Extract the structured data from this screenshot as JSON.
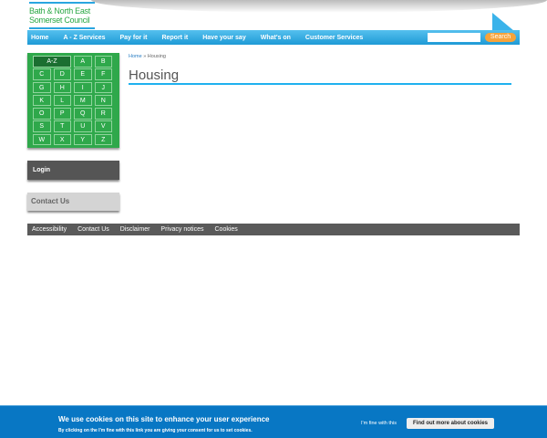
{
  "logo": {
    "line1": "Bath & North East",
    "line2": "Somerset Council"
  },
  "nav": [
    "Home",
    "A - Z Services",
    "Pay for it",
    "Report it",
    "Have your say",
    "What's on",
    "Customer Services"
  ],
  "search": {
    "placeholder": "",
    "button": "Search"
  },
  "az": {
    "all": "A-Z",
    "letters": [
      "A",
      "B",
      "C",
      "D",
      "E",
      "F",
      "G",
      "H",
      "I",
      "J",
      "K",
      "L",
      "M",
      "N",
      "O",
      "P",
      "Q",
      "R",
      "S",
      "T",
      "U",
      "V",
      "W",
      "X",
      "Y",
      "Z"
    ]
  },
  "sidebar": {
    "login": "Login",
    "contact": "Contact Us"
  },
  "breadcrumb": {
    "home": "Home",
    "sep": " » ",
    "current": "Housing"
  },
  "page_title": "Housing",
  "footer": [
    "Accessibility",
    "Contact Us",
    "Disclaimer",
    "Privacy notices",
    "Cookies"
  ],
  "cookie": {
    "title": "We use cookies on this site to enhance your user experience",
    "text": "By clicking on the I'm fine with this link you are giving your consent for us to set cookies.",
    "accept": "I'm fine with this",
    "more": "Find out more about cookies"
  }
}
